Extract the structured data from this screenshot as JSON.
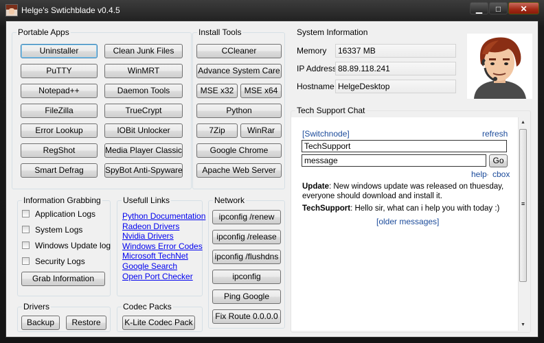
{
  "window": {
    "title": "Helge's Swtichblade v0.4.5",
    "minimize_glyph": "▁",
    "maximize_glyph": "□",
    "close_glyph": "✕"
  },
  "portable_apps": {
    "title": "Portable Apps",
    "left": [
      "Uninstaller",
      "PuTTY",
      "Notepad++",
      "FileZilla",
      "Error Lookup",
      "RegShot",
      "Smart Defrag"
    ],
    "right": [
      "Clean Junk Files",
      "WinMRT",
      "Daemon Tools",
      "TrueCrypt",
      "IOBit Unlocker",
      "Media Player Classic",
      "SpyBot Anti-Spyware"
    ]
  },
  "install_tools": {
    "title": "Install Tools",
    "ccleaner": "CCleaner",
    "advance_system_care": "Advance System Care",
    "mse_x32": "MSE x32",
    "mse_x64": "MSE x64",
    "python": "Python",
    "zip7": "7Zip",
    "winrar": "WinRar",
    "google_chrome": "Google Chrome",
    "apache": "Apache Web Server"
  },
  "system_info": {
    "title": "System Information",
    "memory_label": "Memory",
    "memory_value": "16337 MB",
    "ip_label": "IP Address",
    "ip_value": "88.89.118.241",
    "hostname_label": "Hostname",
    "hostname_value": "HelgeDesktop"
  },
  "information_grabbing": {
    "title": "Information Grabbing",
    "checkboxes": [
      "Application Logs",
      "System Logs",
      "Windows Update log",
      "Security Logs"
    ],
    "grab_button": "Grab Information"
  },
  "useful_links": {
    "title": "Usefull Links",
    "links": [
      "Python Documentation",
      "Radeon Drivers",
      "Nvidia Drivers",
      "Windows Error Codes",
      "Microsoft TechNet",
      "Google Search",
      "Open Port Checker"
    ]
  },
  "network": {
    "title": "Network",
    "buttons": [
      "ipconfig /renew",
      "ipconfig /release",
      "ipconfig /flushdns",
      "ipconfig",
      "Ping Google",
      "Fix Route 0.0.0.0"
    ]
  },
  "drivers": {
    "title": "Drivers",
    "backup": "Backup",
    "restore": "Restore"
  },
  "codec_packs": {
    "title": "Codec Packs",
    "klite": "K-Lite Codec Pack"
  },
  "chat": {
    "title": "Tech Support Chat",
    "switchnode": "[Switchnode]",
    "refresh": "refresh",
    "name_value": "TechSupport",
    "message_value": "message",
    "go_button": "Go",
    "help": "help",
    "separator": "·",
    "cbox": "cbox",
    "messages": [
      {
        "author": "Update",
        "text": ": New windows update was released on thuesday, everyone should download and install it."
      },
      {
        "author": "TechSupport",
        "text": ": Hello sir, what can i help you with today :)"
      }
    ],
    "older_messages": "[older messages]",
    "scroll_up_glyph": "▲",
    "scroll_down_glyph": "▼",
    "grip_glyph": "≡"
  }
}
